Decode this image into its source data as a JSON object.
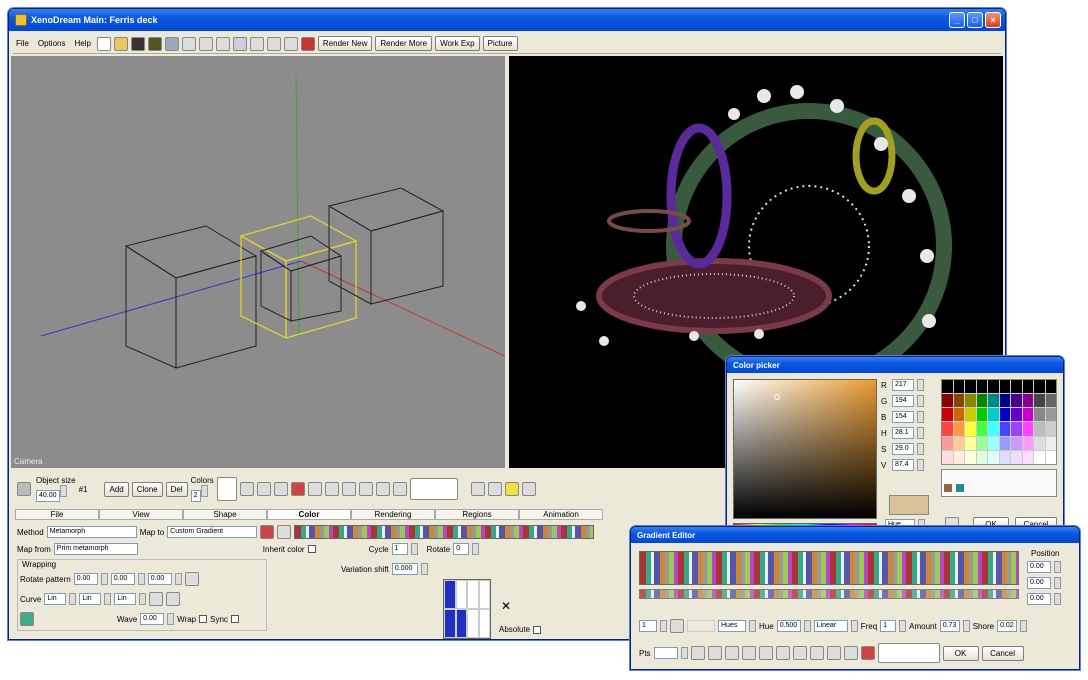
{
  "main_window": {
    "title": "XenoDream Main: Ferris deck",
    "title_buttons": [
      "_",
      "□",
      "×"
    ]
  },
  "menu": {
    "items": [
      "File",
      "Options",
      "Help"
    ]
  },
  "toolbar": {
    "render_new": "Render New",
    "render_more": "Render More",
    "work_exp": "Work Exp",
    "picture": "Picture"
  },
  "viewport": {
    "label": "Camera",
    "axis_colors": {
      "x": "#c03030",
      "y": "#30a030",
      "z": "#3030c0"
    },
    "selected_color": "#e0d030"
  },
  "lower_panel": {
    "object_label": "Object size",
    "object_value": "40.00",
    "object_extra": "#1",
    "buttons": [
      "Add",
      "Clone",
      "Del"
    ],
    "colors_label": "Colors",
    "colors_value": "2",
    "tabs": [
      "File",
      "View",
      "Shape",
      "Color",
      "Rendering",
      "Regions",
      "Animation"
    ],
    "method_label": "Method",
    "method_value": "Metamorph",
    "map_to_label": "Map to",
    "map_to_value": "Custom Gradient",
    "map_from_label": "Map from",
    "map_from_value": "Prim metamorph",
    "inherit_label": "Inherit color",
    "cycle_label": "Cycle",
    "cycle_value": "1",
    "rotate_label": "Rotate",
    "rotate_value": "0",
    "variation_label": "Variation shift",
    "variation_value": "0.000",
    "wrapping_label": "Wrapping",
    "rotate_pattern_label": "Rotate pattern",
    "rp_values": [
      "0.00",
      "0.00",
      "0.00"
    ],
    "curve_label": "Curve",
    "curve_values": [
      "Lin",
      "Lin",
      "Lin"
    ],
    "wave_label": "Wave",
    "wave_value": "0.00",
    "wrap_label": "Wrap",
    "sync_label": "Sync",
    "absolute_label": "Absolute"
  },
  "color_picker": {
    "title": "Color picker",
    "fields": [
      {
        "label": "R",
        "value": "217"
      },
      {
        "label": "G",
        "value": "194"
      },
      {
        "label": "B",
        "value": "154"
      },
      {
        "label": "H",
        "value": "28.1"
      },
      {
        "label": "S",
        "value": "29.0"
      },
      {
        "label": "V",
        "value": "87.4"
      }
    ],
    "mode": "Hue",
    "ok": "OK",
    "cancel": "Cancel",
    "swatch": "#d9c29a"
  },
  "gradient_editor": {
    "title": "Gradient Editor",
    "position_label": "Position",
    "pos_values": [
      "0.00",
      "0.00",
      "0.00"
    ],
    "index_value": "1",
    "mode_value": "Hues",
    "hue_label": "Hue",
    "hue_value": "0.500",
    "interp_value": "Linear",
    "freq_label": "Freq",
    "freq_value": "1",
    "amount_label": "Amount",
    "amount_value": "0.73",
    "shore_label": "Shore",
    "shore_value": "0.02",
    "pts_label": "Pts",
    "ok": "OK",
    "cancel": "Cancel"
  }
}
